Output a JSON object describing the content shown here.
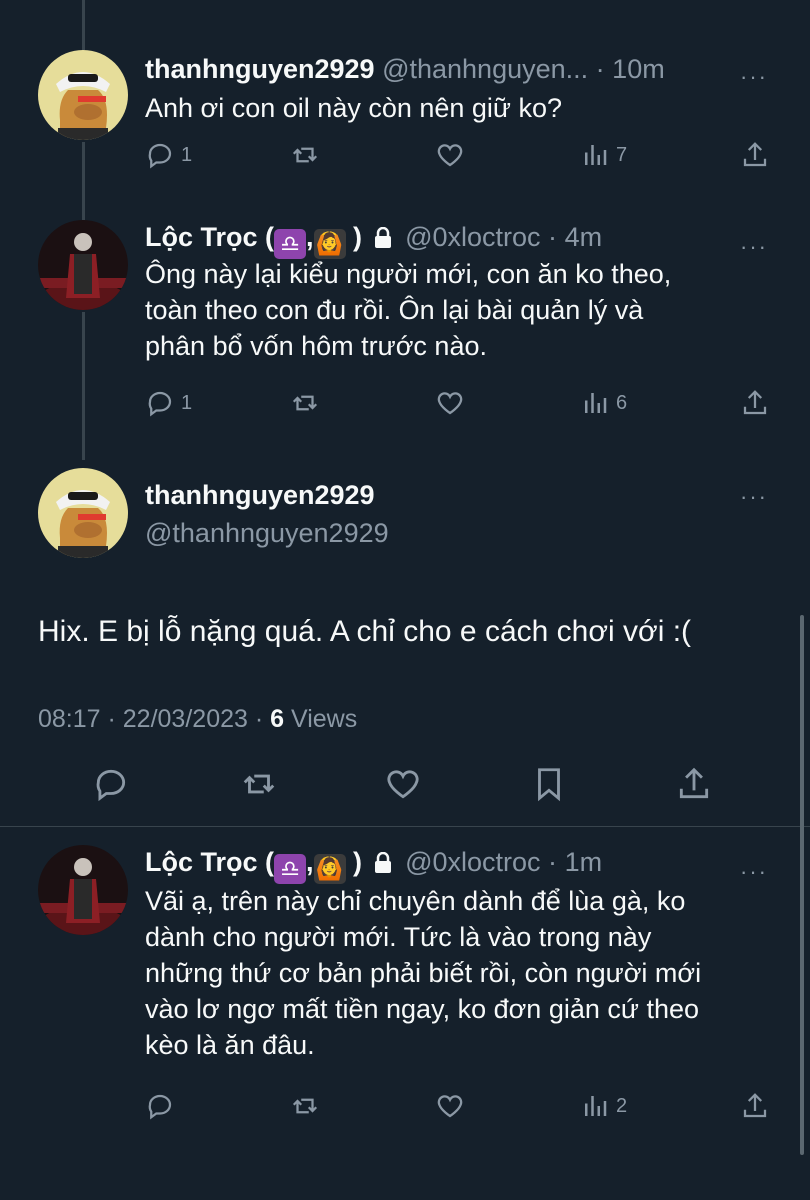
{
  "tweets": [
    {
      "name": "thanhnguyen2929",
      "handle": "@thanhnguyen...",
      "dot": "·",
      "time": "10m",
      "more": "···",
      "text": "Anh ơi con oil này còn nên giữ ko?",
      "replies": "1",
      "views": "7",
      "avatar": "ape-avatar"
    },
    {
      "name": "Lộc Trọc (",
      "emoji1": "♎",
      "comma": ",",
      "emoji2": "🙆",
      "close": ")",
      "handle": "@0xloctroc",
      "dot": "·",
      "time": "4m",
      "more": "···",
      "text_lines": [
        "Ông này lại kiểu người mới, con ăn ko theo,",
        "toàn theo con đu rồi. Ôn lại bài quản lý và",
        "phân bổ vốn hôm trước nào."
      ],
      "replies": "1",
      "views": "6",
      "avatar": "person-car-avatar"
    }
  ],
  "main": {
    "name": "thanhnguyen2929",
    "handle": "@thanhnguyen2929",
    "more": "···",
    "text": "Hix. E bị lỗ nặng quá. A chỉ cho e cách chơi với :(",
    "timestamp": "08:17 · 22/03/2023 · ",
    "views_count": "6",
    "views_label": " Views"
  },
  "reply": {
    "name": "Lộc Trọc (",
    "emoji1": "♎",
    "comma": ",",
    "emoji2": "🙆",
    "close": ")",
    "handle": "@0xloctroc",
    "dot": "·",
    "time": "1m",
    "more": "···",
    "text_lines": [
      "Vãi ạ, trên này chỉ chuyên dành để lùa gà, ko",
      "dành cho người mới. Tức là vào trong này",
      "những thứ cơ bản phải biết rồi, còn người mới",
      "vào lơ ngơ mất tiền ngay, ko đơn giản cứ theo",
      "kèo là ăn đâu."
    ],
    "views": "2"
  },
  "colors": {
    "background": "#15202b",
    "text": "#f7f9f9",
    "muted": "#8b98a5",
    "divider": "#38444d"
  }
}
